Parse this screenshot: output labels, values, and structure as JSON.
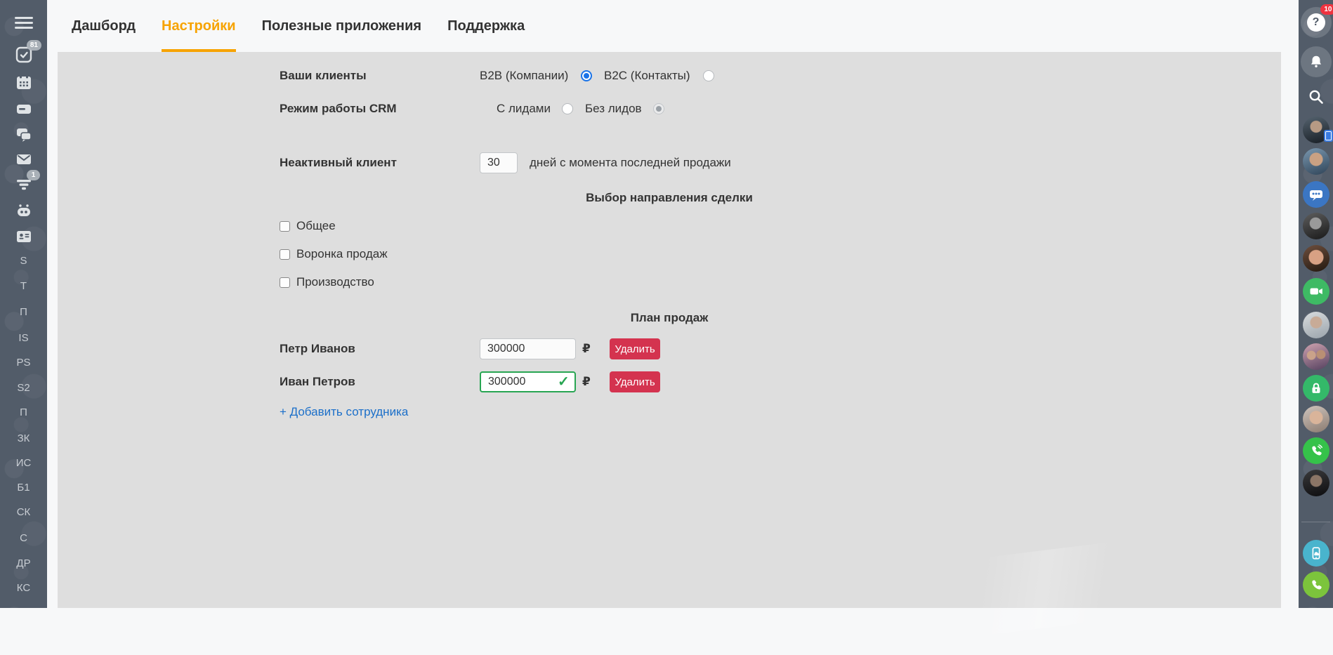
{
  "header": {
    "tabs": [
      {
        "label": "Дашборд",
        "active": false
      },
      {
        "label": "Настройки",
        "active": true
      },
      {
        "label": "Полезные приложения",
        "active": false
      },
      {
        "label": "Поддержка",
        "active": false
      }
    ]
  },
  "left_sidebar": {
    "icons": [
      "menu-icon",
      "tasks-icon",
      "calendar-icon",
      "drive-icon",
      "chat-icon",
      "mail-icon",
      "crm-funnel-icon",
      "bot-icon",
      "contact-card-icon"
    ],
    "tasks_badge": "81",
    "crm_badge": "1",
    "letters": [
      "S",
      "T",
      "П",
      "IS",
      "PS",
      "S2",
      "П",
      "ЗК",
      "ИС",
      "Б1",
      "СК",
      "С",
      "ДР",
      "КС"
    ]
  },
  "right_rail": {
    "help_badge": "10",
    "icons": [
      "help-icon",
      "bell-icon",
      "search-icon",
      "group-chat-icon",
      "video-call-icon",
      "lock-icon",
      "phone-waves-icon",
      "mobile-cloud-icon",
      "phone-icon"
    ],
    "avatar_count": 8
  },
  "form": {
    "clients": {
      "label": "Ваши клиенты",
      "options": [
        {
          "label": "B2B (Компании)",
          "selected": true
        },
        {
          "label": "B2C (Контакты)",
          "selected": false
        }
      ]
    },
    "crm_mode": {
      "label": "Режим работы CRM",
      "options": [
        {
          "label": "С лидами",
          "selected": false
        },
        {
          "label": "Без лидов",
          "selected": true,
          "disabled": true
        }
      ]
    },
    "inactive_client": {
      "label": "Неактивный клиент",
      "value": "30",
      "suffix": "дней с момента последней продажи"
    },
    "deal_direction": {
      "title": "Выбор направления сделки",
      "checkboxes": [
        {
          "label": "Общее",
          "checked": false
        },
        {
          "label": "Воронка продаж",
          "checked": false
        },
        {
          "label": "Производство",
          "checked": false
        }
      ]
    },
    "sales_plan": {
      "title": "План продаж",
      "currency": "₽",
      "delete_label": "Удалить",
      "add_label": "+ Добавить сотрудника",
      "rows": [
        {
          "name": "Петр Иванов",
          "value": "300000",
          "valid": false
        },
        {
          "name": "Иван Петров",
          "value": "300000",
          "valid": true
        }
      ]
    }
  },
  "colors": {
    "accent_orange": "#f7a300",
    "button_red": "#d4334f",
    "link_blue": "#1b6fc9",
    "radio_blue": "#1a73e8",
    "valid_green": "#28a552",
    "sidebar_bg": "#525c69",
    "panel_gray": "#dedede"
  }
}
